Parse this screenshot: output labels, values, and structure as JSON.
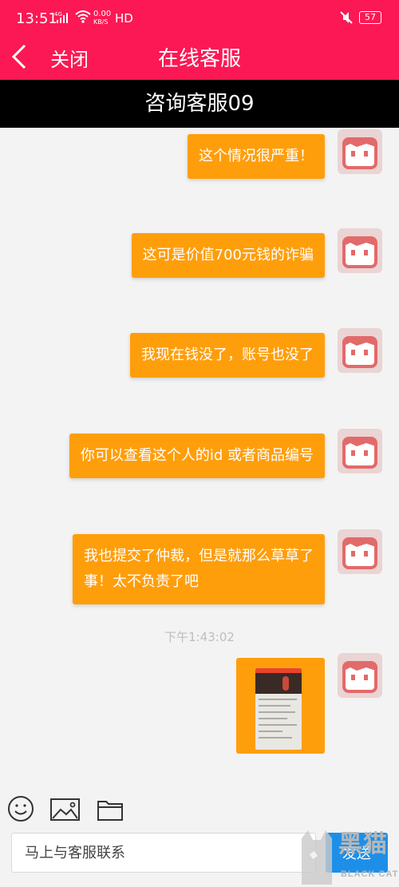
{
  "status_bar": {
    "time": "13:51",
    "network": "4G",
    "speed_value": "0.00",
    "speed_unit": "KB/S",
    "hd": "HD",
    "battery": "57"
  },
  "header": {
    "close_label": "关闭",
    "title": "在线客服"
  },
  "agent": {
    "name": "咨询客服09"
  },
  "messages": [
    {
      "text": "这个情况很严重！"
    },
    {
      "text": "这可是价值700元钱的诈骗"
    },
    {
      "text": "我现在钱没了，账号也没了"
    },
    {
      "text": "你可以查看这个人的id 或者商品编号"
    },
    {
      "text_line1": "我也提交了仲裁，但是就那么草草了",
      "text_line2": "事！太不负责了吧"
    }
  ],
  "timestamp": "下午1:43:02",
  "input": {
    "placeholder": "马上与客服联系",
    "send_label": "发送"
  },
  "watermark": {
    "text": "黑猫",
    "sub": "BLACK CAT"
  },
  "colors": {
    "header": "#fc1854",
    "bubble": "#ff9e0b",
    "send": "#1e8fe8",
    "agent_bar": "#000000"
  }
}
